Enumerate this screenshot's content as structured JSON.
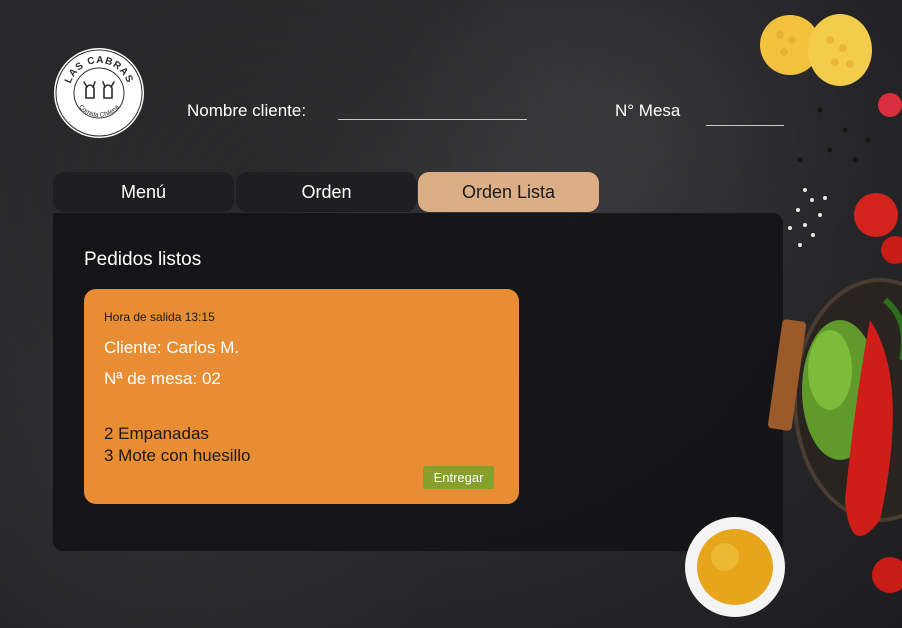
{
  "logo": {
    "name": "LAS CABRAS",
    "tagline": "Comida Chilena"
  },
  "header": {
    "customer_label": "Nombre cliente:",
    "customer_value": "",
    "table_label": "N° Mesa",
    "table_value": ""
  },
  "tabs": [
    {
      "label": "Menú",
      "active": false
    },
    {
      "label": "Orden",
      "active": false
    },
    {
      "label": "Orden Lista",
      "active": true
    }
  ],
  "panel": {
    "title": "Pedidos listos",
    "orders": [
      {
        "time": "Hora de salida 13:15",
        "customer": "Cliente: Carlos M.",
        "table": "Nª de mesa: 02",
        "items": [
          "2 Empanadas",
          "3 Mote con huesillo"
        ],
        "action_label": "Entregar"
      }
    ]
  },
  "colors": {
    "background": "#2b2b2d",
    "tab_inactive": "#1f1f22",
    "tab_active": "#dcae86",
    "card": "#e88d33",
    "button": "#85a02b"
  }
}
